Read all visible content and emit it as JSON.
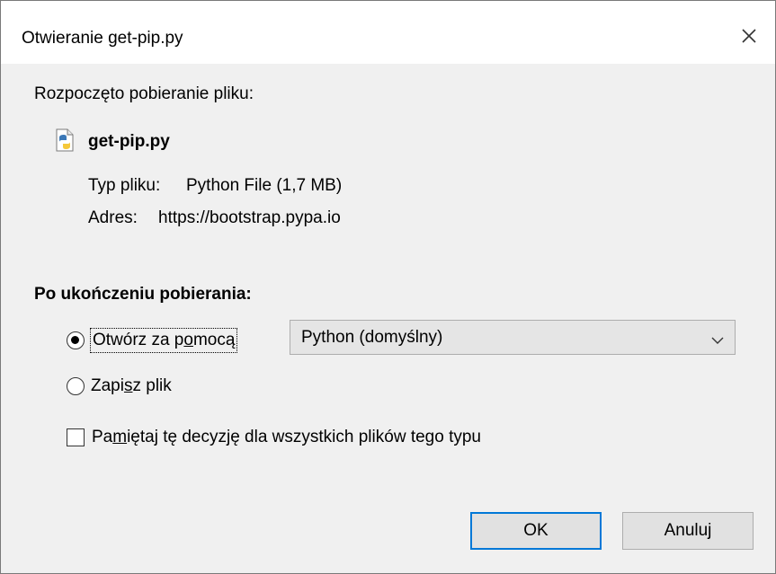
{
  "window": {
    "title": "Otwieranie get-pip.py",
    "close_icon": "close-icon"
  },
  "download": {
    "intro": "Rozpoczęto pobieranie pliku:",
    "file_icon": "python-file-icon",
    "file_name": "get-pip.py",
    "type_label": "Typ pliku:",
    "type_value": "Python File (1,7 MB)",
    "address_label": "Adres:",
    "address_value": "https://bootstrap.pypa.io"
  },
  "after_download": {
    "heading": "Po ukończeniu pobierania:",
    "open_with": {
      "label_before": "Otwórz za p",
      "label_underlined": "o",
      "label_after": "mocą",
      "selected": true
    },
    "app_select": {
      "value": "Python (domyślny)",
      "arrow_icon": "chevron-down-icon"
    },
    "save_file": {
      "label_before": "Zapi",
      "label_underlined": "s",
      "label_after": "z plik",
      "selected": false
    },
    "remember": {
      "label_before": "Pa",
      "label_underlined": "m",
      "label_after": "iętaj tę decyzję dla wszystkich plików tego typu",
      "checked": false
    }
  },
  "buttons": {
    "ok": "OK",
    "cancel": "Anuluj"
  },
  "colors": {
    "dialog_background": "#f0f0f0",
    "title_background": "#ffffff",
    "focus_border": "#0078d7",
    "button_background": "#e1e1e1"
  }
}
